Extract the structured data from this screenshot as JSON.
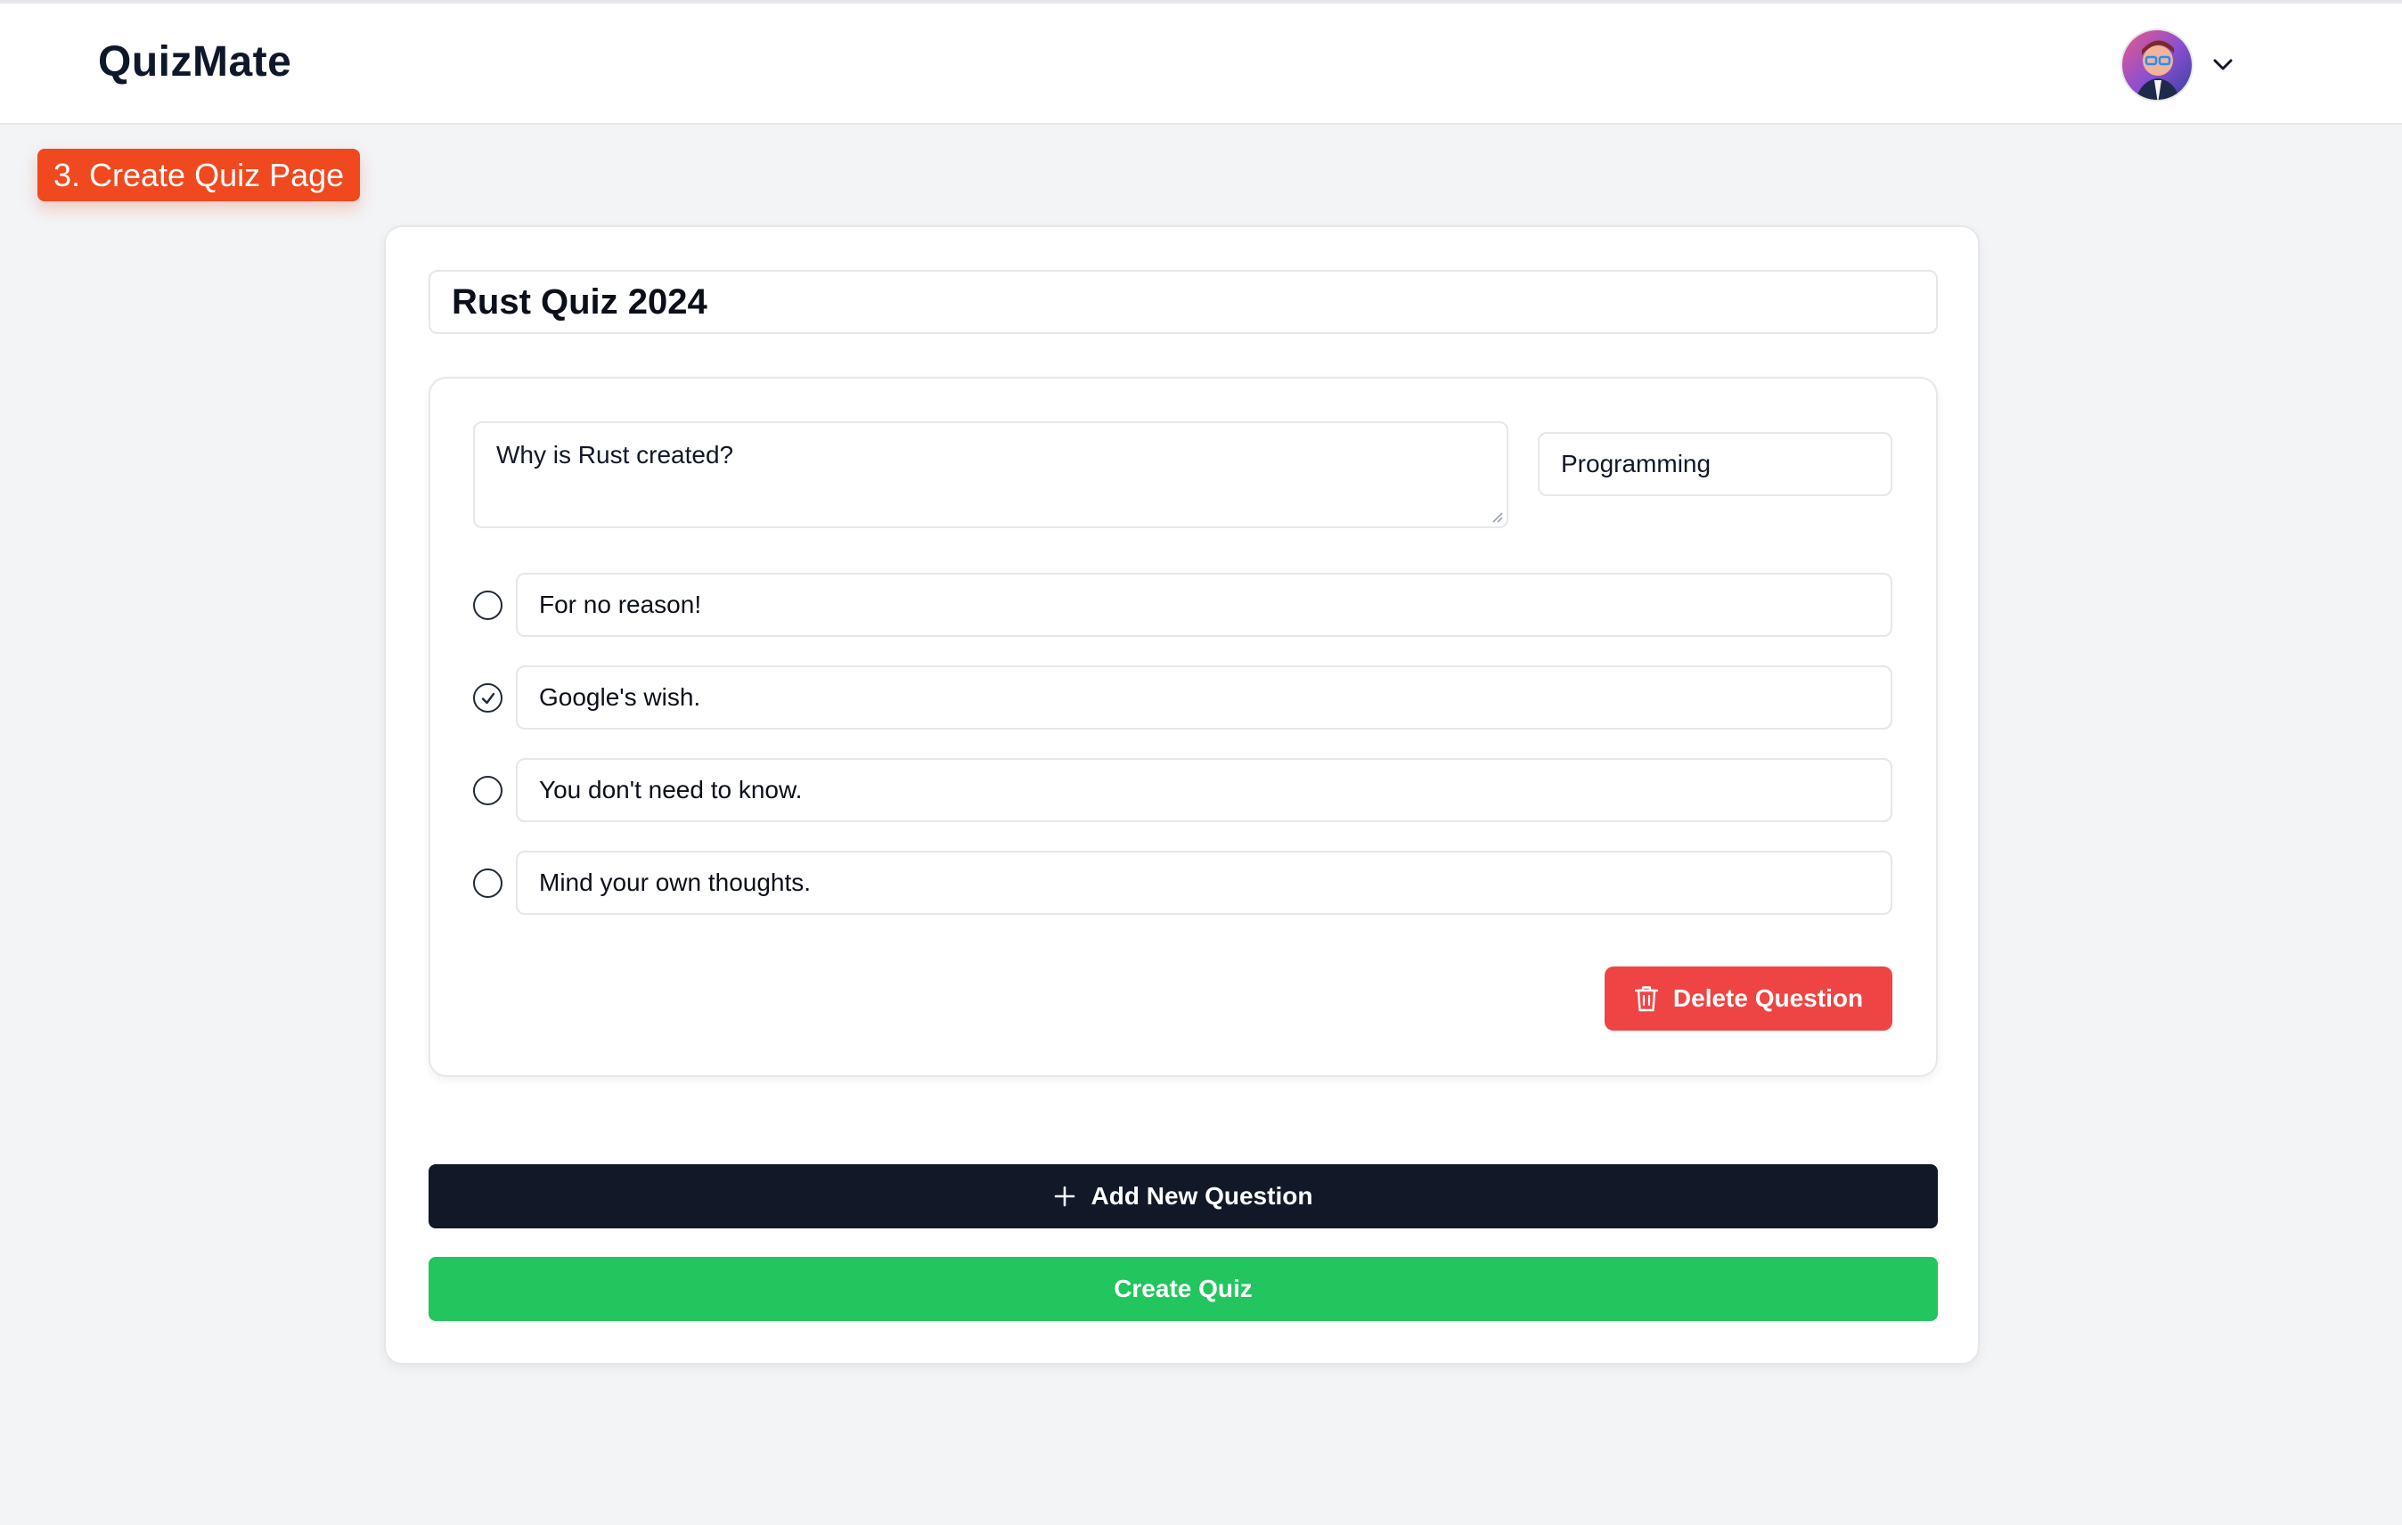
{
  "app": {
    "brand": "QuizMate"
  },
  "header": {
    "avatar_icon": "user-avatar",
    "menu_icon": "chevron-down-icon"
  },
  "annotation": {
    "label": "3. Create Quiz Page",
    "color": "#f0481f"
  },
  "quiz": {
    "title": "Rust Quiz 2024",
    "questions": [
      {
        "text": "Why is Rust created?",
        "category": "Programming",
        "options": [
          {
            "label": "For no reason!",
            "selected": false
          },
          {
            "label": "Google's wish.",
            "selected": true
          },
          {
            "label": "You don't need to know.",
            "selected": false
          },
          {
            "label": "Mind your own thoughts.",
            "selected": false
          }
        ],
        "delete_label": "Delete Question",
        "delete_icon": "trash-icon"
      }
    ]
  },
  "actions": {
    "add_question_label": "Add New Question",
    "add_icon": "plus-icon",
    "create_label": "Create Quiz"
  },
  "colors": {
    "danger": "#ef4444",
    "primary_dark": "#111827",
    "success": "#22c55e"
  }
}
